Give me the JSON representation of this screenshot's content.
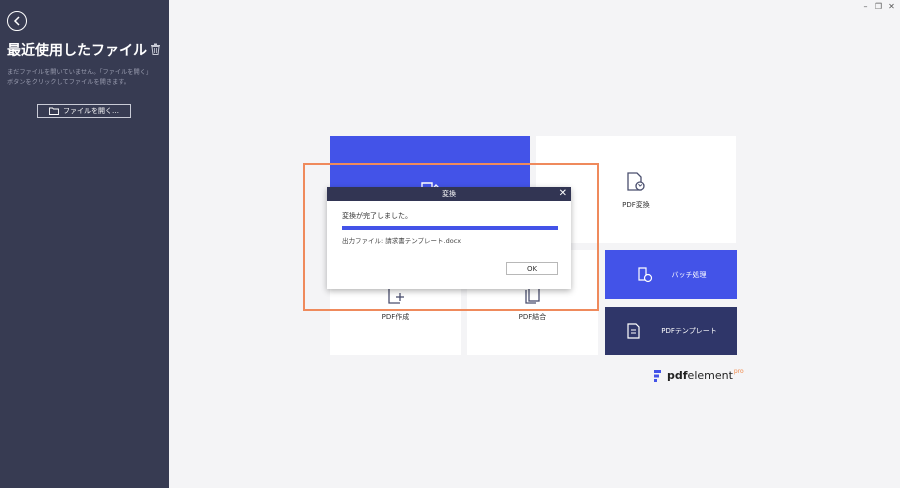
{
  "sidebar": {
    "title": "最近使用したファイル",
    "empty_message": "まだファイルを開いていません。「ファイルを開く」ボタンをクリックしてファイルを開きます。",
    "open_file_label": "ファイルを開く…"
  },
  "tiles": {
    "convert_label": "PDF変換",
    "create_label": "PDF作成",
    "combine_label": "PDF結合",
    "batch_label": "バッチ処理",
    "template_label": "PDFテンプレート"
  },
  "logo": {
    "pdf": "pdf",
    "element": "element",
    "pro": "pro"
  },
  "dialog": {
    "title": "変換",
    "message": "変換が完了しました。",
    "output_file": "出力ファイル: 請求書テンプレート.docx",
    "ok_label": "OK",
    "progress": 1.0
  },
  "colors": {
    "sidebar_bg": "#373b52",
    "accent_blue": "#4353e8",
    "dark_navy": "#2f3669",
    "highlight": "#ef8a5c",
    "brand_orange": "#f08a4b"
  }
}
